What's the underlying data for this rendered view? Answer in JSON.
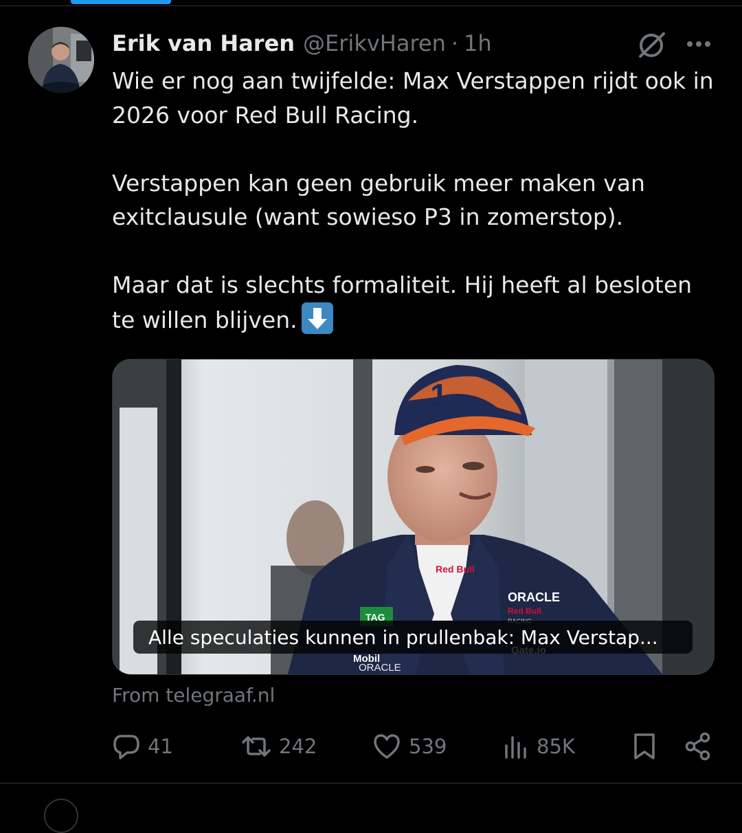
{
  "tweet": {
    "author": {
      "name": "Erik van Haren",
      "handle": "@ErikvHaren",
      "time": "1h",
      "separator": "·"
    },
    "text": {
      "p1": "Wie er nog aan twijfelde: Max Verstappen rijdt ook in 2026 voor Red Bull Racing.",
      "p2": "Verstappen kan geen gebruik meer maken van exitclausule (want sowieso P3 in zomerstop).",
      "p3": "Maar dat is slechts formaliteit. Hij heeft al besloten te willen blijven."
    },
    "card": {
      "title": "Alle speculaties kunnen in prullenbak: Max Verstap...",
      "source": "From telegraaf.nl",
      "image_text": {
        "cap_number": "1",
        "sponsor_redbull": "Red Bull",
        "sponsor_oracle": "ORACLE",
        "sponsor_racing": "RACING",
        "sponsor_tag": "TAG",
        "sponsor_mobil": "Mobil",
        "sponsor_gate": "Gate.io",
        "sponsor_oracle_2": "ORACLE"
      }
    },
    "actions": {
      "replies": "41",
      "reposts": "242",
      "likes": "539",
      "views": "85K"
    }
  },
  "colors": {
    "background": "#000000",
    "text_primary": "#e7e9ea",
    "text_secondary": "#71767b",
    "divider": "#2f3336",
    "accent": "#1d9bf0",
    "emoji_blue": "#3b88c3"
  },
  "icons": [
    "grok-icon",
    "more-icon",
    "arrow-down-emoji",
    "reply-icon",
    "repost-icon",
    "like-icon",
    "views-icon",
    "bookmark-icon",
    "share-icon"
  ]
}
